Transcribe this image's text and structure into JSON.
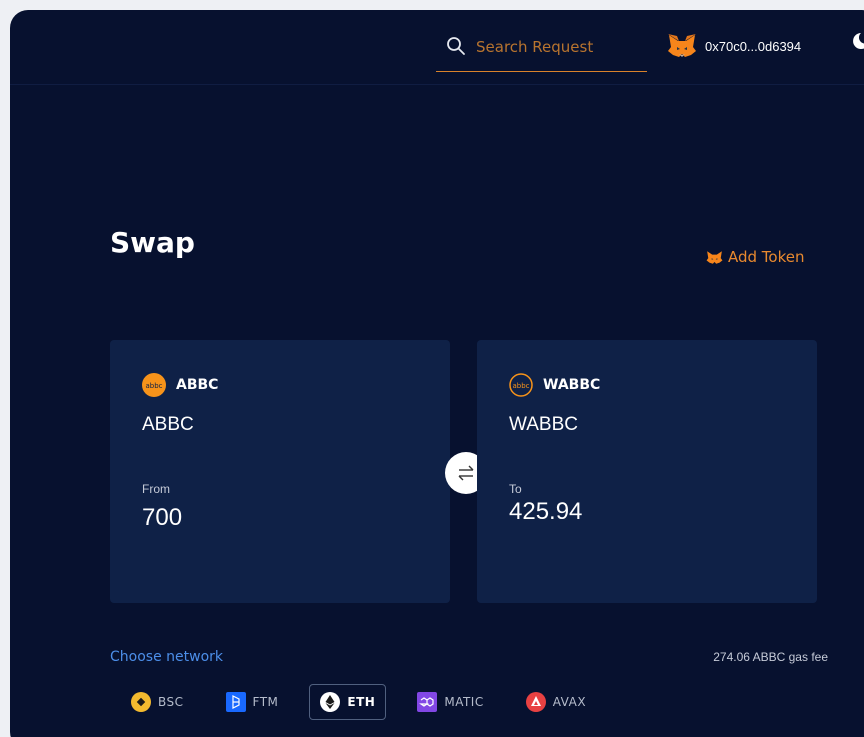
{
  "header": {
    "search_placeholder": "Search Request",
    "wallet_address": "0x70c0...0d6394"
  },
  "page": {
    "title": "Swap",
    "add_token_label": "Add Token"
  },
  "swap": {
    "from": {
      "symbol": "ABBC",
      "name": "ABBC",
      "direction_label": "From",
      "amount": "700"
    },
    "to": {
      "symbol": "WABBC",
      "name": "WABBC",
      "direction_label": "To",
      "amount": "425.94"
    }
  },
  "network": {
    "choose_label": "Choose network",
    "gas_fee": "274.06 ABBC gas fee",
    "options": [
      {
        "label": "BSC",
        "icon": "bsc-icon",
        "color": "#f3ba2f"
      },
      {
        "label": "FTM",
        "icon": "ftm-icon",
        "color": "#1969ff"
      },
      {
        "label": "ETH",
        "icon": "eth-icon",
        "color": "#ffffff",
        "selected": true
      },
      {
        "label": "MATIC",
        "icon": "matic-icon",
        "color": "#8247e5"
      },
      {
        "label": "AVAX",
        "icon": "avax-icon",
        "color": "#e84142"
      }
    ]
  },
  "colors": {
    "background": "#07112f",
    "card": "#0f2147",
    "accent": "#e8892f",
    "link": "#4c8ee8"
  }
}
